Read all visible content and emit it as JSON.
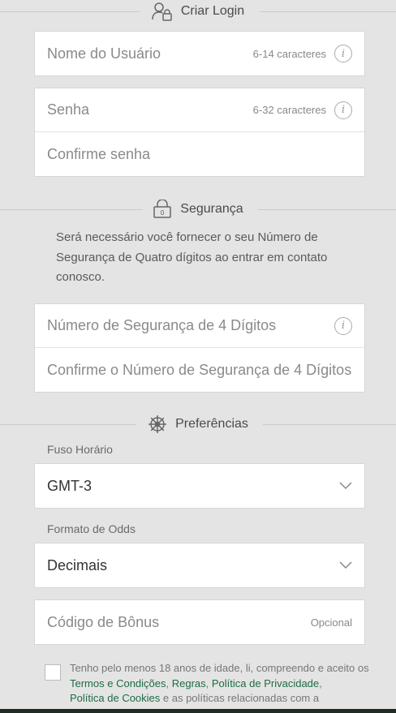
{
  "login_section": {
    "title": "Criar Login",
    "username": {
      "placeholder": "Nome do Usuário",
      "hint": "6-14 caracteres"
    },
    "password": {
      "placeholder": "Senha",
      "hint": "6-32 caracteres"
    },
    "confirm_password": {
      "placeholder": "Confirme senha"
    }
  },
  "security_section": {
    "title": "Segurança",
    "description": "Será necessário você fornecer o seu Número de Segurança de Quatro dígitos ao entrar em contato conosco.",
    "pin": {
      "placeholder": "Número de Segurança de 4 Dígitos"
    },
    "confirm_pin": {
      "placeholder": "Confirme o Número de Segurança de 4 Dígitos"
    }
  },
  "preferences_section": {
    "title": "Preferências",
    "timezone": {
      "label": "Fuso Horário",
      "value": "GMT-3"
    },
    "odds_format": {
      "label": "Formato de Odds",
      "value": "Decimais"
    },
    "bonus_code": {
      "placeholder": "Código de Bônus",
      "hint": "Opcional"
    }
  },
  "terms": {
    "text_before": "Tenho pelo menos 18 anos de idade, li, compreendo e aceito os ",
    "link_terms": "Termos e Condições",
    "sep1": ", ",
    "link_rules": "Regras",
    "sep2": ", ",
    "link_privacy": "Política de Privacidade",
    "sep3": ",",
    "link_cookies": "Política de Cookies",
    "text_after": " e as políticas relacionadas com a"
  },
  "colors": {
    "background": "#e4e4e4",
    "link": "#1f6b45"
  }
}
